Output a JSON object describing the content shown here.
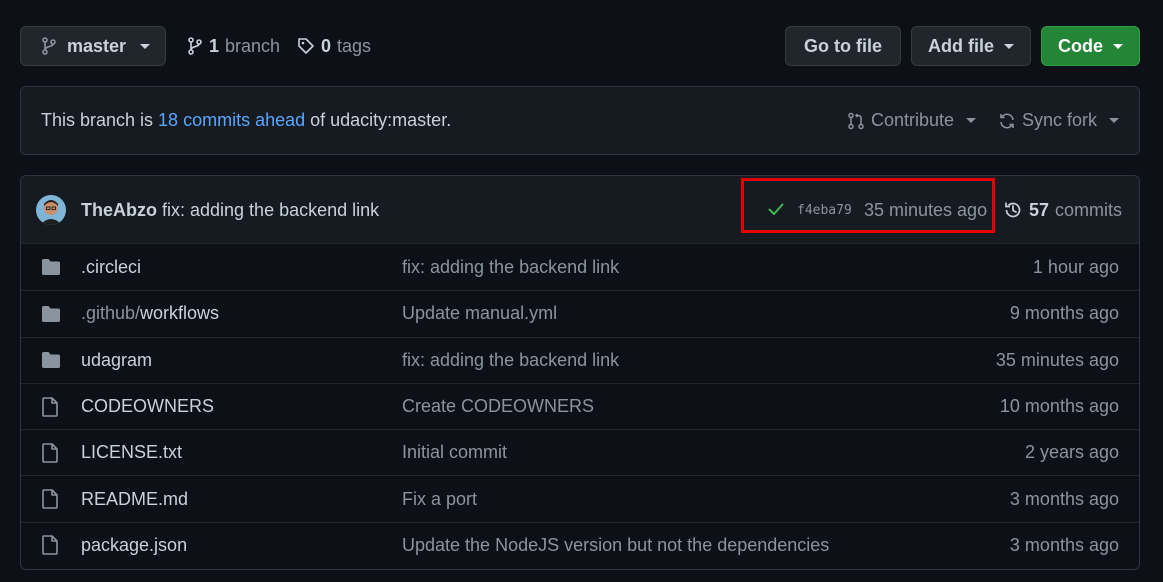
{
  "toolbar": {
    "branch_name": "master",
    "branch_count": "1",
    "branch_label": "branch",
    "tag_count": "0",
    "tag_label": "tags",
    "go_to_file": "Go to file",
    "add_file": "Add file",
    "code": "Code"
  },
  "branch_info": {
    "prefix": "This branch is",
    "link": "18 commits ahead",
    "suffix": "of udacity:master.",
    "contribute": "Contribute",
    "sync_fork": "Sync fork"
  },
  "latest_commit": {
    "author": "TheAbzo",
    "message": "fix: adding the backend link",
    "sha": "f4eba79",
    "time": "35 minutes ago",
    "commit_count": "57",
    "commit_label": "commits",
    "status": "success"
  },
  "files": [
    {
      "type": "folder",
      "prefix": "",
      "name": ".circleci",
      "message": "fix: adding the backend link",
      "age": "1 hour ago"
    },
    {
      "type": "folder",
      "prefix": ".github/",
      "name": "workflows",
      "message": "Update manual.yml",
      "age": "9 months ago"
    },
    {
      "type": "folder",
      "prefix": "",
      "name": "udagram",
      "message": "fix: adding the backend link",
      "age": "35 minutes ago"
    },
    {
      "type": "file",
      "prefix": "",
      "name": "CODEOWNERS",
      "message": "Create CODEOWNERS",
      "age": "10 months ago"
    },
    {
      "type": "file",
      "prefix": "",
      "name": "LICENSE.txt",
      "message": "Initial commit",
      "age": "2 years ago"
    },
    {
      "type": "file",
      "prefix": "",
      "name": "README.md",
      "message": "Fix a port",
      "age": "3 months ago"
    },
    {
      "type": "file",
      "prefix": "",
      "name": "package.json",
      "message": "Update the NodeJS version but not the dependencies",
      "age": "3 months ago"
    }
  ],
  "colors": {
    "background": "#0d1117",
    "link": "#58a6ff",
    "green_button": "#238636",
    "highlight": "#e60000",
    "check": "#3fb950"
  }
}
